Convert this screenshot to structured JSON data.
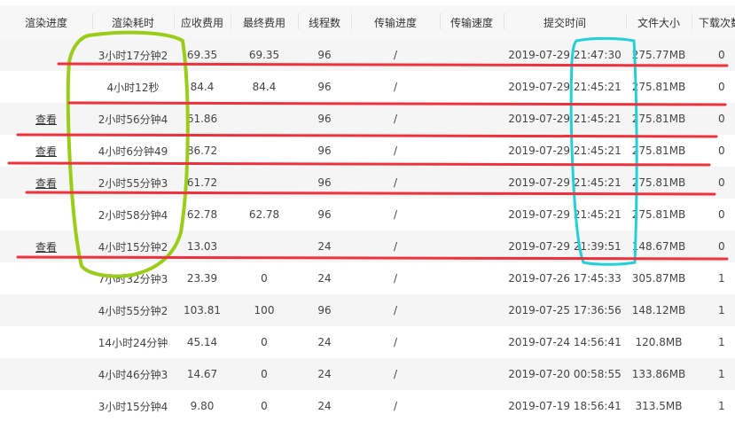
{
  "columns": [
    "渲染进度",
    "渲染耗时",
    "应收费用",
    "最终费用",
    "线程数",
    "传输进度",
    "传输速度",
    "提交时间",
    "文件大小",
    "下载次数"
  ],
  "rows": [
    {
      "progress": "",
      "duration": "3小时17分钟2",
      "due_fee": "69.35",
      "final_fee": "69.35",
      "threads": "96",
      "transfer": "/",
      "speed": "",
      "submit_time": "2019-07-29 21:47:30",
      "size": "275.77MB",
      "downloads": "0"
    },
    {
      "progress": "",
      "duration": "4小时12秒",
      "due_fee": "84.4",
      "final_fee": "84.4",
      "threads": "96",
      "transfer": "/",
      "speed": "",
      "submit_time": "2019-07-29 21:45:21",
      "size": "275.81MB",
      "downloads": "0"
    },
    {
      "progress": "查看",
      "duration": "2小时56分钟4",
      "due_fee": "61.86",
      "final_fee": "",
      "threads": "96",
      "transfer": "/",
      "speed": "",
      "submit_time": "2019-07-29 21:45:21",
      "size": "275.81MB",
      "downloads": "0"
    },
    {
      "progress": "查看",
      "duration": "4小时6分钟49",
      "due_fee": "86.72",
      "final_fee": "",
      "threads": "96",
      "transfer": "/",
      "speed": "",
      "submit_time": "2019-07-29 21:45:21",
      "size": "275.81MB",
      "downloads": "0"
    },
    {
      "progress": "查看",
      "duration": "2小时55分钟3",
      "due_fee": "61.72",
      "final_fee": "",
      "threads": "96",
      "transfer": "/",
      "speed": "",
      "submit_time": "2019-07-29 21:45:21",
      "size": "275.81MB",
      "downloads": "0"
    },
    {
      "progress": "",
      "duration": "2小时58分钟4",
      "due_fee": "62.78",
      "final_fee": "62.78",
      "threads": "96",
      "transfer": "/",
      "speed": "",
      "submit_time": "2019-07-29 21:45:21",
      "size": "275.81MB",
      "downloads": "0"
    },
    {
      "progress": "查看",
      "duration": "4小时15分钟2",
      "due_fee": "13.03",
      "final_fee": "",
      "threads": "24",
      "transfer": "/",
      "speed": "",
      "submit_time": "2019-07-29 21:39:51",
      "size": "148.67MB",
      "downloads": "0"
    },
    {
      "progress": "",
      "duration": "7小时32分钟3",
      "due_fee": "23.39",
      "final_fee": "0",
      "threads": "24",
      "transfer": "/",
      "speed": "",
      "submit_time": "2019-07-26 17:45:33",
      "size": "305.87MB",
      "downloads": "1"
    },
    {
      "progress": "",
      "duration": "4小时55分钟2",
      "due_fee": "103.81",
      "final_fee": "100",
      "threads": "96",
      "transfer": "/",
      "speed": "",
      "submit_time": "2019-07-25 17:36:56",
      "size": "148.12MB",
      "downloads": "1"
    },
    {
      "progress": "",
      "duration": "14小时24分钟",
      "due_fee": "45.14",
      "final_fee": "0",
      "threads": "24",
      "transfer": "/",
      "speed": "",
      "submit_time": "2019-07-24 14:56:41",
      "size": "120.8MB",
      "downloads": "1"
    },
    {
      "progress": "",
      "duration": "4小时46分钟3",
      "due_fee": "14.67",
      "final_fee": "0",
      "threads": "24",
      "transfer": "/",
      "speed": "",
      "submit_time": "2019-07-20 00:58:55",
      "size": "133.86MB",
      "downloads": "1"
    },
    {
      "progress": "",
      "duration": "3小时15分钟4",
      "due_fee": "9.80",
      "final_fee": "0",
      "threads": "24",
      "transfer": "/",
      "speed": "",
      "submit_time": "2019-07-19 18:56:41",
      "size": "313.5MB",
      "downloads": "1"
    }
  ],
  "annotation_colors": {
    "green": "#9acd18",
    "cyan": "#22d0d8",
    "red": "#f0303a"
  }
}
